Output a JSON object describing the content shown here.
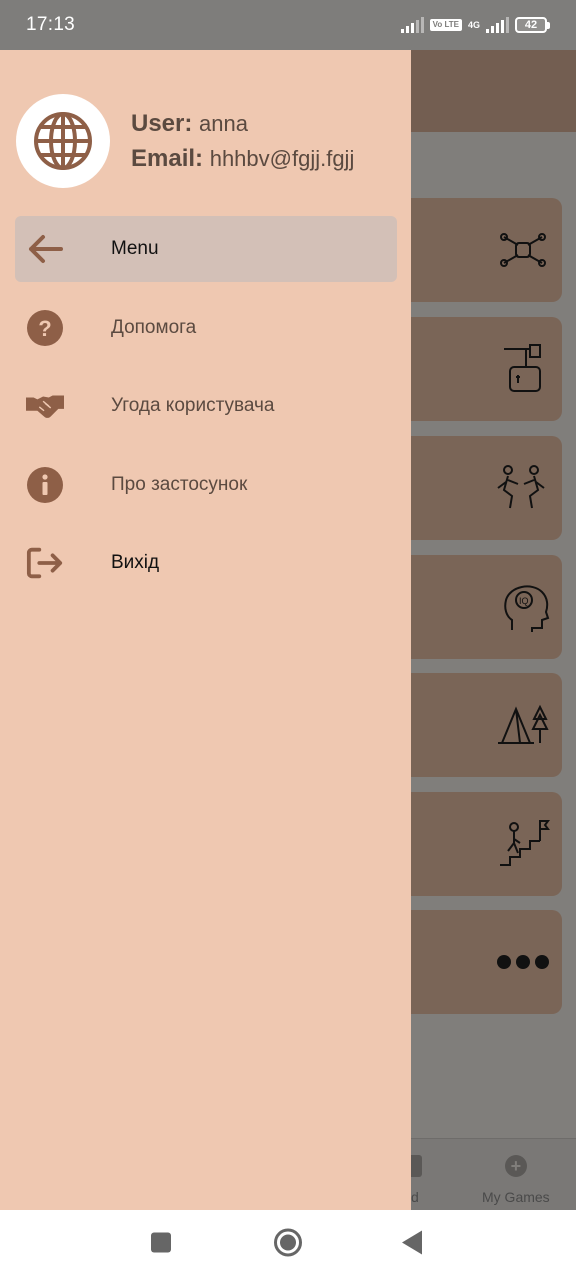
{
  "status_bar": {
    "time": "17:13",
    "volte": "Vo LTE",
    "network": "4G",
    "battery": "42"
  },
  "drawer": {
    "user_key": "User:",
    "user_value": "anna",
    "email_key": "Email:",
    "email_value": "hhhbv@fgjj.fgjj",
    "avatar_icon": "globe-icon",
    "items": [
      {
        "label": "Menu",
        "icon": "arrow-left-icon",
        "active": true
      },
      {
        "label": "Допомога",
        "icon": "question-circle-icon"
      },
      {
        "label": "Угода користувача",
        "icon": "handshake-icon"
      },
      {
        "label": "Про застосунок",
        "icon": "info-circle-icon"
      },
      {
        "label": "Вихід",
        "icon": "logout-icon"
      }
    ]
  },
  "background": {
    "tab_partial_label": "ed",
    "tab_my_games_label": "My Games"
  },
  "colors": {
    "drawer_bg": "#efc8b1",
    "accent_brown": "#8e5f47",
    "active_item_bg": "#d3c0b7",
    "text_brown": "#5b4a40"
  }
}
